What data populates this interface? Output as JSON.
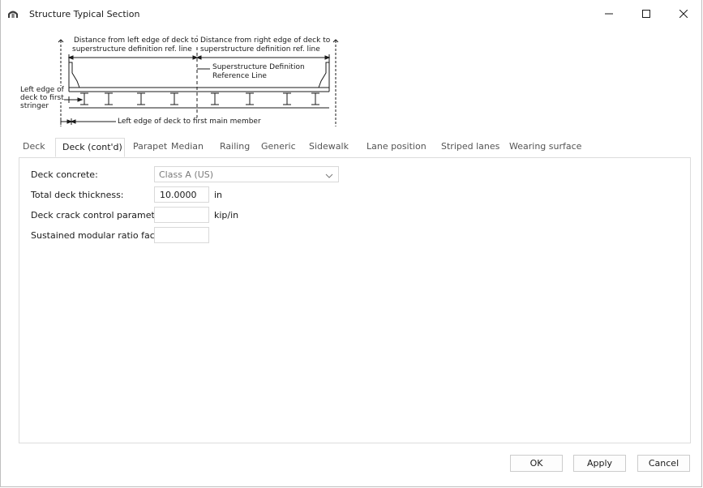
{
  "window": {
    "title": "Structure Typical Section",
    "icon": "bridge-icon",
    "controls": [
      "minimize-icon",
      "maximize-icon",
      "close-icon"
    ]
  },
  "diagram": {
    "label_left_top": "Distance from left edge of deck to",
    "label_left_bottom": "superstructure definition ref. line",
    "label_right_top": "Distance from right edge of deck to",
    "label_right_bottom": "superstructure definition ref. line",
    "label_ref_top": "Superstructure Definition",
    "label_ref_bottom": "Reference Line",
    "label_stringer_1": "Left edge of",
    "label_stringer_2": "deck to first",
    "label_stringer_3": "stringer",
    "label_bottom": "Left edge of deck to first main member"
  },
  "tabs": [
    {
      "label": "Deck"
    },
    {
      "label": "Deck (cont'd)"
    },
    {
      "label": "Parapet"
    },
    {
      "label": "Median"
    },
    {
      "label": "Railing"
    },
    {
      "label": "Generic"
    },
    {
      "label": "Sidewalk"
    },
    {
      "label": "Lane position"
    },
    {
      "label": "Striped lanes"
    },
    {
      "label": "Wearing surface"
    }
  ],
  "active_tab": "Deck (cont'd)",
  "form": {
    "deck_concrete": {
      "label": "Deck concrete:",
      "value": "Class A (US)"
    },
    "total_deck_thickness": {
      "label": "Total deck thickness:",
      "value": "10.0000",
      "unit": "in"
    },
    "deck_crack_control": {
      "label": "Deck crack control parameter:",
      "value": "",
      "unit": "kip/in"
    },
    "sustained_modular_ratio": {
      "label": "Sustained modular ratio factor:",
      "value": ""
    }
  },
  "buttons": {
    "ok": "OK",
    "apply": "Apply",
    "cancel": "Cancel"
  }
}
